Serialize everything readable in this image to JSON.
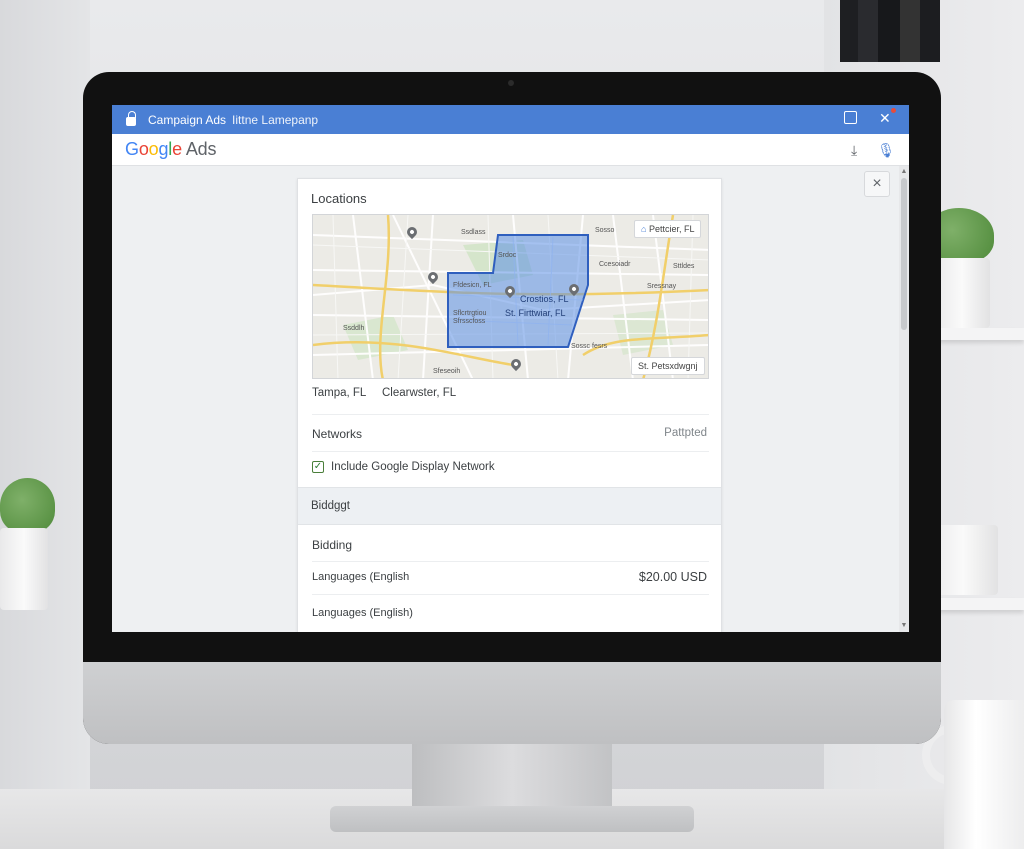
{
  "window": {
    "title": "Campaign Ads",
    "subtitle": "Iittne Lamepanp"
  },
  "app": {
    "logo": {
      "g1": "G",
      "o1": "o",
      "o2": "o",
      "g2": "g",
      "l": "l",
      "e": "e",
      "ads": "Ads"
    }
  },
  "dialog": {
    "close_glyph": "×",
    "locations": {
      "title": "Locations",
      "map": {
        "badge_top": "Pettcier, FL",
        "badge_bottom": "St. Petsxdwgnj",
        "area_labels": [
          "Crostios, FL",
          "St. Firttwiar, FL"
        ],
        "street_labels": [
          "Ssdlass",
          "Srdoc",
          "Sosso",
          "Ccesoiadr",
          "Sttldes",
          "Sressnay",
          "Ssddlh",
          "Sfeseoih",
          "Sossc fesrs"
        ],
        "small_labels": [
          "Ffdesicn, FL",
          "Sflcrtrgtiou",
          "Sfrsscfoss"
        ]
      },
      "cities": [
        "Tampa, FL",
        "Clearwster, FL"
      ]
    },
    "networks": {
      "label": "Networks",
      "status": "Pattpted",
      "checkbox_label": "Include Google Display Network",
      "checked": true
    },
    "budget": {
      "label": "Biddggt"
    },
    "bidding": {
      "label": "Bidding"
    },
    "languages_row": {
      "label": "Languages (English",
      "value": "$20.00 USD"
    },
    "languages_row2": {
      "label": "Languages (English)"
    }
  },
  "colors": {
    "titlebar": "#4a7fd4",
    "map_area": "#5b8fe6",
    "check": "#2e7d32"
  }
}
